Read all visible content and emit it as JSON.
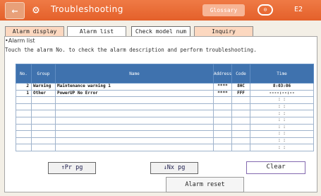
{
  "header": {
    "back_icon": "←",
    "tool_icon": "⚙",
    "title": "Troubleshooting",
    "glossary_label": "Glossary",
    "icon2": "⊙",
    "icon3": "E2"
  },
  "tabs": [
    {
      "label": "Alarm display"
    },
    {
      "label": "Alarm list"
    },
    {
      "label": "Check model num"
    },
    {
      "label": "Inquiry"
    }
  ],
  "section": {
    "title": "•Alarm list",
    "instruction": "Touch the alarm No. to check the alarm description and perform troubleshooting."
  },
  "table": {
    "headers": {
      "no": "No.",
      "group": "Group",
      "name": "Name",
      "address": "Address",
      "code": "Code",
      "time": "Time"
    },
    "rows": [
      {
        "no": "2",
        "group": "Warning",
        "name": "Maintenance warning 1",
        "address": "****",
        "code": "8HC",
        "time": "8:03:06"
      },
      {
        "no": "1",
        "group": "Other",
        "name": "PowerUP No Error",
        "address": "****",
        "code": "FFF",
        "time": "----:--:--"
      },
      {
        "no": "",
        "group": "",
        "name": "",
        "address": "",
        "code": "",
        "time": ": :"
      },
      {
        "no": "",
        "group": "",
        "name": "",
        "address": "",
        "code": "",
        "time": ": :"
      },
      {
        "no": "",
        "group": "",
        "name": "",
        "address": "",
        "code": "",
        "time": ": :"
      },
      {
        "no": "",
        "group": "",
        "name": "",
        "address": "",
        "code": "",
        "time": ": :"
      },
      {
        "no": "",
        "group": "",
        "name": "",
        "address": "",
        "code": "",
        "time": ": :"
      },
      {
        "no": "",
        "group": "",
        "name": "",
        "address": "",
        "code": "",
        "time": ": :"
      },
      {
        "no": "",
        "group": "",
        "name": "",
        "address": "",
        "code": "",
        "time": ": :"
      },
      {
        "no": "",
        "group": "",
        "name": "",
        "address": "",
        "code": "",
        "time": ": :"
      }
    ]
  },
  "buttons": {
    "prev_page": "↑Pr pg",
    "next_page": "↓Nx pg",
    "clear": "Clear",
    "alarm_reset": "Alarm reset"
  },
  "colors": {
    "header_bg": "#e4602a",
    "table_header_bg": "#3f72ae",
    "tab_inactive_bg": "#fcd8c0"
  }
}
